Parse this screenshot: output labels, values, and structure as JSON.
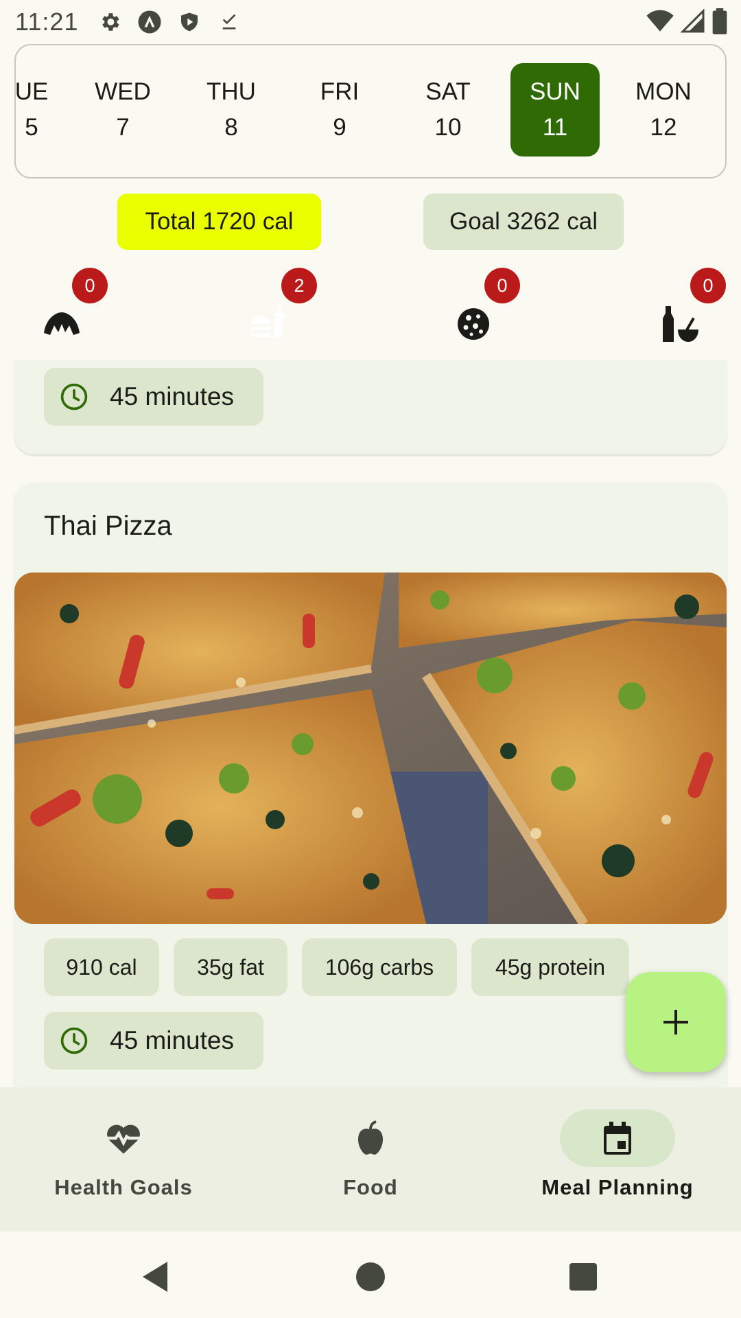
{
  "status_bar": {
    "time": "11:21",
    "icons": [
      "settings-icon",
      "a-icon",
      "shield-play-icon",
      "download-done-icon"
    ],
    "right_icons": [
      "wifi-icon",
      "signal-icon",
      "battery-icon"
    ]
  },
  "date_strip": {
    "days": [
      {
        "dow": "UE",
        "num": "5"
      },
      {
        "dow": "WED",
        "num": "7"
      },
      {
        "dow": "THU",
        "num": "8"
      },
      {
        "dow": "FRI",
        "num": "9"
      },
      {
        "dow": "SAT",
        "num": "10"
      },
      {
        "dow": "SUN",
        "num": "11"
      },
      {
        "dow": "MON",
        "num": "12"
      }
    ],
    "selected_index": 5
  },
  "calories": {
    "total_label": "Total 1720 cal",
    "goal_label": "Goal 3262 cal"
  },
  "meal_tabs": [
    {
      "icon": "croissant-icon",
      "count": "0"
    },
    {
      "icon": "lunch-dining-icon",
      "count": "2"
    },
    {
      "icon": "cookie-icon",
      "count": "0"
    },
    {
      "icon": "drinks-icon",
      "count": "0"
    }
  ],
  "previous_card": {
    "time": "45 minutes"
  },
  "recipe_card": {
    "title": "Thai Pizza",
    "image": "thai-pizza-photo",
    "calories": "910 cal",
    "fat": "35g fat",
    "carbs": "106g carbs",
    "protein": "45g protein",
    "time": "45 minutes"
  },
  "fab": {
    "icon": "plus-icon"
  },
  "bottom_nav": {
    "items": [
      {
        "label": "Health Goals",
        "icon": "heart-pulse-icon"
      },
      {
        "label": "Food",
        "icon": "apple-icon"
      },
      {
        "label": "Meal Planning",
        "icon": "calendar-icon"
      }
    ],
    "active_index": 2
  },
  "colors": {
    "selected_day": "#2f6a05",
    "total_chip": "#eaff00",
    "tag_bg": "#dbe6cc",
    "badge": "#ba1a1a",
    "fab": "#b8f283",
    "active_meal": "#38656a"
  }
}
